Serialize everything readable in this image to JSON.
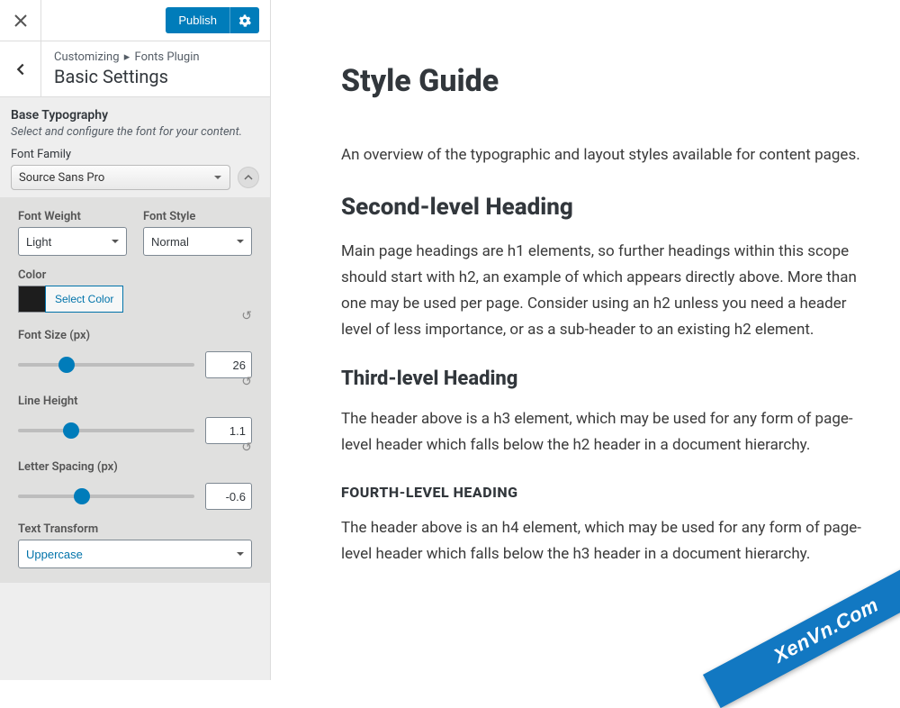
{
  "topbar": {
    "publish_label": "Publish"
  },
  "section": {
    "breadcrumb_prefix": "Customizing",
    "breadcrumb_separator": "▸",
    "breadcrumb_parent": "Fonts Plugin",
    "title": "Basic Settings"
  },
  "panel": {
    "title": "Base Typography",
    "description": "Select and configure the font for your content.",
    "font_family_label": "Font Family",
    "font_family_value": "Source Sans Pro",
    "font_weight_label": "Font Weight",
    "font_weight_value": "Light",
    "font_style_label": "Font Style",
    "font_style_value": "Normal",
    "color_label": "Color",
    "color_button": "Select Color",
    "color_value": "#1d1d1d",
    "font_size_label": "Font Size (px)",
    "font_size_value": "26",
    "line_height_label": "Line Height",
    "line_height_value": "1.1",
    "letter_spacing_label": "Letter Spacing (px)",
    "letter_spacing_value": "-0.6",
    "text_transform_label": "Text Transform",
    "text_transform_value": "Uppercase"
  },
  "preview": {
    "h1": "Style Guide",
    "intro": "An overview of the typographic and layout styles available for content pages.",
    "h2": "Second-level Heading",
    "p2": "Main page headings are h1 elements, so further headings within this scope should start with h2, an example of which appears directly above. More than one may be used per page. Consider using an h2 unless you need a header level of less importance, or as a sub-header to an existing h2 element.",
    "h3": "Third-level Heading",
    "p3": "The header above is a h3 element, which may be used for any form of page-level header which falls below the h2 header in a document hierarchy.",
    "h4": "Fourth-level Heading",
    "p4": "The header above is an h4 element, which may be used for any form of page-level header which falls below the h3 header in a document hierarchy."
  },
  "watermark": "XenVn.Com"
}
